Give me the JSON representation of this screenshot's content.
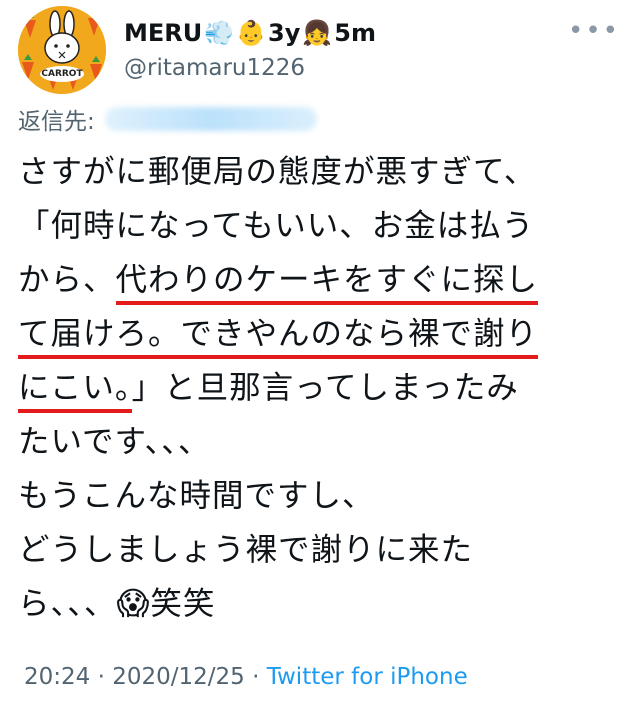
{
  "author": {
    "display_name": "MERU",
    "name_emojis": [
      "💨",
      "👶",
      "3y",
      "👧",
      "5m"
    ],
    "handle": "@ritamaru1226",
    "avatar_text": "CARROT"
  },
  "reply": {
    "label": "返信先:"
  },
  "tweet": {
    "lines": [
      "さすがに郵便局の態度が悪すぎて、",
      [
        "「何時になってもいい、お金は払う"
      ],
      [
        "から、",
        "代わりのケーキをすぐに探し",
        ""
      ],
      [
        "",
        "て届けろ。できやんのなら裸で謝り",
        ""
      ],
      [
        "",
        "にこい。",
        "」と旦那言ってしまったみ"
      ],
      "たいです、、、",
      "もうこんな時間ですし、",
      "どうしましょう裸で謝りに来た",
      [
        "ら、、、",
        "😱",
        "笑笑"
      ]
    ]
  },
  "meta": {
    "time": "20:24",
    "separator": "·",
    "date": "2020/12/25",
    "source": "Twitter for iPhone"
  },
  "colors": {
    "underline": "#e31b1b",
    "link": "#1d9bf0",
    "muted": "#536471",
    "avatar_bg": "#f2a81d"
  }
}
